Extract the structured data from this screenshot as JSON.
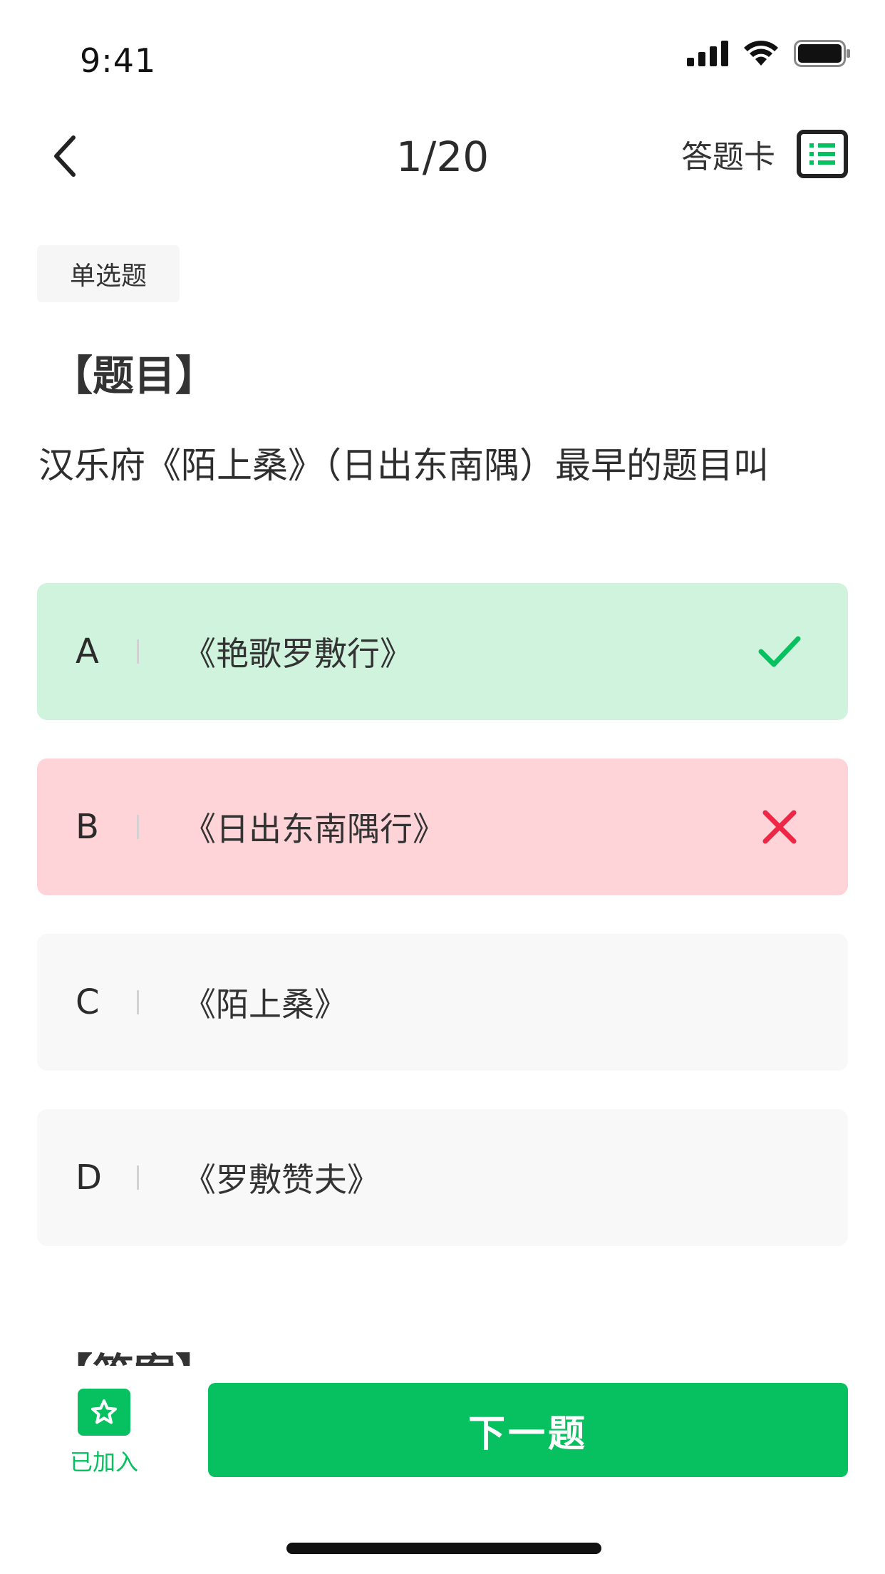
{
  "status_bar": {
    "time": "9:41"
  },
  "nav": {
    "progress": "1/20",
    "answer_card_label": "答题卡"
  },
  "question": {
    "type": "单选题",
    "section_title": "【题目】",
    "text": "汉乐府《陌上桑》（日出东南隅）最早的题目叫",
    "options": [
      {
        "letter": "A",
        "text": "《艳歌罗敷行》",
        "state": "correct"
      },
      {
        "letter": "B",
        "text": "《日出东南隅行》",
        "state": "wrong"
      },
      {
        "letter": "C",
        "text": "《陌上桑》",
        "state": "none"
      },
      {
        "letter": "D",
        "text": "《罗敷赞夫》",
        "state": "none"
      }
    ]
  },
  "answer": {
    "section_title": "【答案】"
  },
  "bottom": {
    "favorite_label": "已加入",
    "next_label": "下一题"
  },
  "colors": {
    "accent": "#07c160",
    "correct_bg": "#cff3dd",
    "wrong_bg": "#ffd4d9",
    "wrong_mark": "#ee2746"
  }
}
